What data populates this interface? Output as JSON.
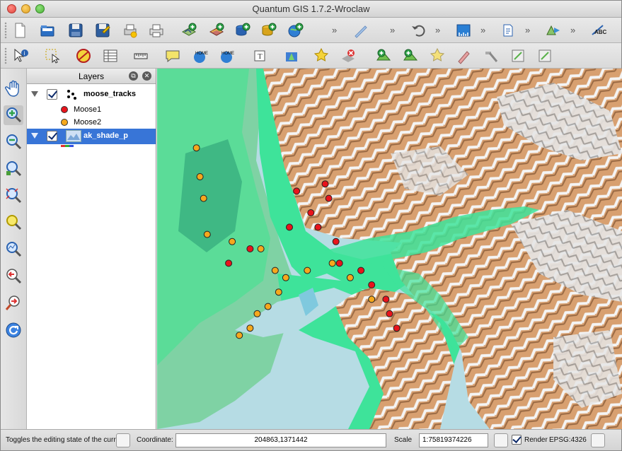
{
  "window": {
    "title": "Quantum GIS 1.7.2-Wroclaw"
  },
  "toolbar_top": {
    "icons": [
      "new-project-icon",
      "open-project-icon",
      "save-project-icon",
      "save-as-icon",
      "print-composer-icon",
      "print-icon",
      "add-vector-layer-icon",
      "add-raster-layer-icon",
      "add-postgis-icon",
      "add-spatialite-icon",
      "add-wms-icon",
      "digitize-icon",
      "undo-icon",
      "measure-line-icon",
      "annotation-icon",
      "snap-icon",
      "label-icon"
    ],
    "overflow": "»"
  },
  "toolbar_second": {
    "icons": [
      "identify-icon",
      "select-icon",
      "deselect-icon",
      "attribute-table-icon",
      "measure-icon",
      "map-tips-icon",
      "new-bookmark-icon",
      "show-bookmarks-icon",
      "text-annotation-icon",
      "layer-visible-icon",
      "new-layer-icon",
      "remove-layer-icon",
      "add-feature-icon",
      "move-feature-icon",
      "node-tool-icon",
      "delete-selected-icon",
      "cut-features-icon",
      "copy-features-icon",
      "paste-features-icon"
    ]
  },
  "left_toolbar": {
    "icons": [
      "pan-icon",
      "zoom-in-icon",
      "zoom-out-icon",
      "zoom-full-icon",
      "zoom-to-selection-icon",
      "zoom-to-layer-icon",
      "zoom-native-icon",
      "zoom-last-icon",
      "zoom-next-icon",
      "refresh-icon"
    ]
  },
  "layers_panel": {
    "title": "Layers",
    "layers": [
      {
        "name": "moose_tracks",
        "checked": true,
        "expanded": true,
        "legend": [
          {
            "label": "Moose1",
            "color": "#e8141c"
          },
          {
            "label": "Moose2",
            "color": "#f5a81d"
          }
        ]
      },
      {
        "name": "ak_shade_p",
        "checked": true,
        "expanded": true,
        "selected": true
      }
    ]
  },
  "map": {
    "colors": {
      "water": "#b6dce4",
      "lowland": "#3ee39a",
      "midland": "#7ed2a0",
      "upland": "#d29a6a",
      "peak": "#e8e8e8"
    },
    "moose1_points": [
      [
        -149.61,
        61.38
      ],
      [
        -149.53,
        61.39
      ],
      [
        -149.52,
        61.37
      ],
      [
        -149.57,
        61.35
      ],
      [
        -149.63,
        61.33
      ],
      [
        -149.55,
        61.33
      ],
      [
        -149.5,
        61.31
      ],
      [
        -149.74,
        61.3
      ],
      [
        -149.8,
        61.28
      ],
      [
        -149.49,
        61.28
      ],
      [
        -149.43,
        61.27
      ],
      [
        -149.4,
        61.25
      ],
      [
        -149.36,
        61.23
      ],
      [
        -149.35,
        61.21
      ],
      [
        -149.33,
        61.19
      ]
    ],
    "moose2_points": [
      [
        -149.89,
        61.44
      ],
      [
        -149.88,
        61.4
      ],
      [
        -149.87,
        61.37
      ],
      [
        -149.86,
        61.32
      ],
      [
        -149.79,
        61.31
      ],
      [
        -149.71,
        61.3
      ],
      [
        -149.67,
        61.27
      ],
      [
        -149.64,
        61.26
      ],
      [
        -149.58,
        61.27
      ],
      [
        -149.51,
        61.28
      ],
      [
        -149.46,
        61.26
      ],
      [
        -149.4,
        61.23
      ],
      [
        -149.66,
        61.24
      ],
      [
        -149.69,
        61.22
      ],
      [
        -149.72,
        61.21
      ],
      [
        -149.74,
        61.19
      ],
      [
        -149.77,
        61.18
      ]
    ]
  },
  "status": {
    "message": "Toggles the editing state of the current",
    "coordinate_label": "Coordinate:",
    "coordinate_value": "204863,1371442",
    "scale_label": "Scale",
    "scale_value": "1:75819374226",
    "render_label": "Render",
    "render_checked": true,
    "crs": "EPSG:4326"
  }
}
